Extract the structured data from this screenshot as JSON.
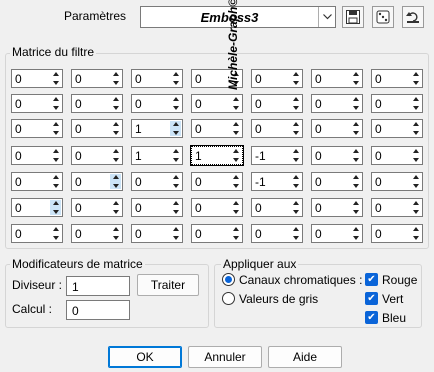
{
  "header": {
    "presets_label": "Paramètres",
    "preset_value": "Emboss3"
  },
  "matrix": {
    "title": "Matrice du filtre",
    "rows": [
      [
        "0",
        "0",
        "0",
        "0",
        "0",
        "0",
        "0"
      ],
      [
        "0",
        "0",
        "0",
        "0",
        "0",
        "0",
        "0"
      ],
      [
        "0",
        "0",
        "1",
        "0",
        "0",
        "0",
        "0"
      ],
      [
        "0",
        "0",
        "1",
        "1",
        "-1",
        "0",
        "0"
      ],
      [
        "0",
        "0",
        "0",
        "0",
        "-1",
        "0",
        "0"
      ],
      [
        "0",
        "0",
        "0",
        "0",
        "0",
        "0",
        "0"
      ],
      [
        "0",
        "0",
        "0",
        "0",
        "0",
        "0",
        "0"
      ]
    ]
  },
  "watermark": "Michèle-Graph©",
  "modifiers": {
    "title": "Modificateurs de matrice",
    "divisor_label": "Diviseur :",
    "divisor_value": "1",
    "offset_label": "Calcul :",
    "offset_value": "0",
    "process_label": "Traiter"
  },
  "apply": {
    "title": "Appliquer aux",
    "option_channels": "Canaux chromatiques :",
    "option_gray": "Valeurs de gris",
    "red": "Rouge",
    "green": "Vert",
    "blue": "Bleu"
  },
  "buttons": {
    "ok": "OK",
    "cancel": "Annuler",
    "help": "Aide"
  },
  "colors": {
    "accent": "#0a64d8",
    "background": "#f0f0f0"
  }
}
